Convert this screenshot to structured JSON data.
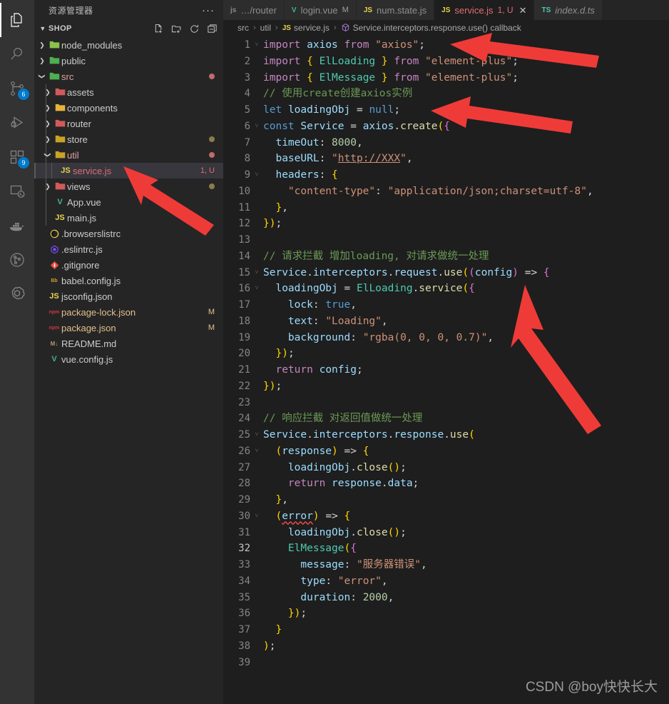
{
  "colors": {
    "activitybar_bg": "#333333",
    "sidebar_bg": "#252526",
    "editor_bg": "#1e1e1e",
    "tab_active_bg": "#1e1e1e",
    "badge_bg": "#007acc",
    "accent_arrow": "#ef3b38",
    "selection_bg": "#37373d",
    "error_red": "#f14c4c"
  },
  "activitybar": {
    "items": [
      {
        "name": "explorer",
        "icon": "files-icon",
        "active": true,
        "badge": ""
      },
      {
        "name": "search",
        "icon": "search-icon",
        "active": false,
        "badge": ""
      },
      {
        "name": "source-control",
        "icon": "source-control-icon",
        "active": false,
        "badge": "6"
      },
      {
        "name": "run-and-debug",
        "icon": "run-debug-icon",
        "active": false,
        "badge": ""
      },
      {
        "name": "extensions",
        "icon": "extensions-icon",
        "active": false,
        "badge": "9"
      },
      {
        "name": "remote-explorer",
        "icon": "remote-explorer-icon",
        "active": false,
        "badge": ""
      },
      {
        "name": "docker",
        "icon": "docker-whale-icon",
        "active": false,
        "badge": ""
      },
      {
        "name": "gitlens",
        "icon": "gitlens-icon",
        "active": false,
        "badge": ""
      },
      {
        "name": "chatgpt",
        "icon": "chatgpt-icon",
        "active": false,
        "badge": ""
      }
    ]
  },
  "sidebar": {
    "title": "资源管理器",
    "more_actions": "···",
    "section": {
      "label": "SHOP",
      "actions": [
        "new-file",
        "new-folder",
        "refresh",
        "collapse-all"
      ]
    },
    "tree": [
      {
        "label": "node_modules",
        "type": "folder",
        "indent": 1,
        "arrow": "collapsed",
        "icon": "folder-node-icon",
        "icon_color": "#8bc34a",
        "color": "#cccccc",
        "badge": "",
        "dot": ""
      },
      {
        "label": "public",
        "type": "folder",
        "indent": 1,
        "arrow": "collapsed",
        "icon": "folder-public-icon",
        "icon_color": "#4caf50",
        "color": "#cccccc",
        "badge": "",
        "dot": ""
      },
      {
        "label": "src",
        "type": "folder",
        "indent": 1,
        "arrow": "expanded",
        "icon": "folder-src-icon",
        "icon_color": "#4caf50",
        "color": "#e2a0a0",
        "badge": "",
        "dot": "#c06c6c"
      },
      {
        "label": "assets",
        "type": "folder",
        "indent": 2,
        "arrow": "collapsed",
        "icon": "folder-assets-icon",
        "icon_color": "#d15a5a",
        "color": "#cccccc",
        "badge": "",
        "dot": ""
      },
      {
        "label": "components",
        "type": "folder",
        "indent": 2,
        "arrow": "collapsed",
        "icon": "folder-components-icon",
        "icon_color": "#e8b339",
        "color": "#cccccc",
        "badge": "",
        "dot": ""
      },
      {
        "label": "router",
        "type": "folder",
        "indent": 2,
        "arrow": "collapsed",
        "icon": "folder-router-icon",
        "icon_color": "#d15a5a",
        "color": "#cccccc",
        "badge": "",
        "dot": ""
      },
      {
        "label": "store",
        "type": "folder",
        "indent": 2,
        "arrow": "collapsed",
        "icon": "folder-store-icon",
        "icon_color": "#c9a227",
        "color": "#cccccc",
        "badge": "",
        "dot": "#8a7b4a"
      },
      {
        "label": "util",
        "type": "folder",
        "indent": 2,
        "arrow": "expanded",
        "icon": "folder-util-icon",
        "icon_color": "#c9a227",
        "color": "#e2a0a0",
        "badge": "",
        "dot": "#c06c6c"
      },
      {
        "label": "service.js",
        "type": "file",
        "indent": 3,
        "arrow": "none",
        "icon": "js-file-icon",
        "icon_color": "#e8d44d",
        "color": "#e06c75",
        "badge": "1, U",
        "badge_color": "#e06c75",
        "dot": "",
        "selected": true
      },
      {
        "label": "views",
        "type": "folder",
        "indent": 2,
        "arrow": "collapsed",
        "icon": "folder-views-icon",
        "icon_color": "#d15a5a",
        "color": "#cccccc",
        "badge": "",
        "dot": "#8a7b4a"
      },
      {
        "label": "App.vue",
        "type": "file",
        "indent": 2,
        "arrow": "none",
        "icon": "vue-file-icon",
        "icon_color": "#41b883",
        "color": "#cccccc",
        "badge": "",
        "dot": ""
      },
      {
        "label": "main.js",
        "type": "file",
        "indent": 2,
        "arrow": "none",
        "icon": "js-file-icon",
        "icon_color": "#e8d44d",
        "color": "#cccccc",
        "badge": "",
        "dot": ""
      },
      {
        "label": ".browserslistrc",
        "type": "file",
        "indent": 1,
        "arrow": "none",
        "icon": "browserslist-file-icon",
        "icon_color": "#f5d547",
        "color": "#cccccc",
        "badge": "",
        "dot": ""
      },
      {
        "label": ".eslintrc.js",
        "type": "file",
        "indent": 1,
        "arrow": "none",
        "icon": "eslint-file-icon",
        "icon_color": "#7c4dff",
        "color": "#cccccc",
        "badge": "",
        "dot": ""
      },
      {
        "label": ".gitignore",
        "type": "file",
        "indent": 1,
        "arrow": "none",
        "icon": "git-file-icon",
        "icon_color": "#e8503a",
        "color": "#cccccc",
        "badge": "",
        "dot": ""
      },
      {
        "label": "babel.config.js",
        "type": "file",
        "indent": 1,
        "arrow": "none",
        "icon": "babel-file-icon",
        "icon_color": "#c9a227",
        "color": "#cccccc",
        "badge": "",
        "dot": ""
      },
      {
        "label": "jsconfig.json",
        "type": "file",
        "indent": 1,
        "arrow": "none",
        "icon": "json-js-file-icon",
        "icon_color": "#e8d44d",
        "color": "#cccccc",
        "badge": "",
        "dot": ""
      },
      {
        "label": "package-lock.json",
        "type": "file",
        "indent": 1,
        "arrow": "none",
        "icon": "npm-file-icon",
        "icon_color": "#cb3837",
        "color": "#e2c08d",
        "badge": "M",
        "badge_color": "#e2c08d",
        "dot": ""
      },
      {
        "label": "package.json",
        "type": "file",
        "indent": 1,
        "arrow": "none",
        "icon": "npm-file-icon",
        "icon_color": "#cb3837",
        "color": "#e2c08d",
        "badge": "M",
        "badge_color": "#e2c08d",
        "dot": ""
      },
      {
        "label": "README.md",
        "type": "file",
        "indent": 1,
        "arrow": "none",
        "icon": "markdown-file-icon",
        "icon_color": "#b9926a",
        "color": "#cccccc",
        "badge": "",
        "dot": ""
      },
      {
        "label": "vue.config.js",
        "type": "file",
        "indent": 1,
        "arrow": "none",
        "icon": "vue-config-file-icon",
        "icon_color": "#41b883",
        "color": "#cccccc",
        "badge": "",
        "dot": ""
      }
    ]
  },
  "tabs": [
    {
      "label": "…/router",
      "icon": "js-icon",
      "icon_text": "js",
      "icon_color": "#8a8a8a",
      "modified": "",
      "badge": "",
      "active": false,
      "closable": false,
      "italic": false
    },
    {
      "label": "login.vue",
      "icon": "vue-icon",
      "icon_text": "V",
      "icon_color": "#41b883",
      "modified": "M",
      "badge": "",
      "active": false,
      "closable": false,
      "italic": false
    },
    {
      "label": "num.state.js",
      "icon": "js-icon",
      "icon_text": "JS",
      "icon_color": "#e8d44d",
      "modified": "",
      "badge": "",
      "active": false,
      "closable": false,
      "italic": false
    },
    {
      "label": "service.js",
      "icon": "js-icon",
      "icon_text": "JS",
      "icon_color": "#e8d44d",
      "modified": "",
      "badge": "1, U",
      "badge_color": "#e06c75",
      "label_color": "#e06c75",
      "active": true,
      "closable": true,
      "close_glyph": "✕",
      "italic": false
    },
    {
      "label": "index.d.ts",
      "icon": "ts-icon",
      "icon_text": "TS",
      "icon_color": "#4ec9b0",
      "modified": "",
      "badge": "",
      "active": false,
      "closable": false,
      "italic": true
    }
  ],
  "breadcrumb": {
    "items": [
      "src",
      "util",
      "service.js",
      "Service.interceptors.response.use() callback"
    ],
    "file_icon_text": "JS",
    "symbol_icon": "symbol-object-icon",
    "separator": "›"
  },
  "editor": {
    "language": "javascript",
    "total_lines": 39,
    "cursor_line": 32,
    "lines": [
      {
        "n": 1,
        "fold": "expanded"
      },
      {
        "n": 2,
        "fold": ""
      },
      {
        "n": 3,
        "fold": ""
      },
      {
        "n": 4,
        "fold": ""
      },
      {
        "n": 5,
        "fold": ""
      },
      {
        "n": 6,
        "fold": "expanded"
      },
      {
        "n": 7,
        "fold": ""
      },
      {
        "n": 8,
        "fold": ""
      },
      {
        "n": 9,
        "fold": "expanded"
      },
      {
        "n": 10,
        "fold": ""
      },
      {
        "n": 11,
        "fold": ""
      },
      {
        "n": 12,
        "fold": ""
      },
      {
        "n": 13,
        "fold": ""
      },
      {
        "n": 14,
        "fold": ""
      },
      {
        "n": 15,
        "fold": "expanded"
      },
      {
        "n": 16,
        "fold": "expanded"
      },
      {
        "n": 17,
        "fold": ""
      },
      {
        "n": 18,
        "fold": ""
      },
      {
        "n": 19,
        "fold": ""
      },
      {
        "n": 20,
        "fold": ""
      },
      {
        "n": 21,
        "fold": ""
      },
      {
        "n": 22,
        "fold": ""
      },
      {
        "n": 23,
        "fold": ""
      },
      {
        "n": 24,
        "fold": ""
      },
      {
        "n": 25,
        "fold": "expanded"
      },
      {
        "n": 26,
        "fold": "expanded"
      },
      {
        "n": 27,
        "fold": ""
      },
      {
        "n": 28,
        "fold": ""
      },
      {
        "n": 29,
        "fold": ""
      },
      {
        "n": 30,
        "fold": "expanded"
      },
      {
        "n": 31,
        "fold": ""
      },
      {
        "n": 32,
        "fold": ""
      },
      {
        "n": 33,
        "fold": ""
      },
      {
        "n": 34,
        "fold": ""
      },
      {
        "n": 35,
        "fold": ""
      },
      {
        "n": 36,
        "fold": ""
      },
      {
        "n": 37,
        "fold": ""
      },
      {
        "n": 38,
        "fold": ""
      },
      {
        "n": 39,
        "fold": ""
      }
    ],
    "source": [
      "import axios from \"axios\";",
      "import { ElLoading } from \"element-plus\";",
      "import { ElMessage } from \"element-plus\";",
      "// 使用create创建axios实例",
      "let loadingObj = null;",
      "const Service = axios.create({",
      "  timeOut: 8000,",
      "  baseURL: \"http://XXX\",",
      "  headers: {",
      "    \"content-type\": \"application/json;charset=utf-8\",",
      "  },",
      "});",
      "",
      "// 请求拦截 增加loading, 对请求做统一处理",
      "Service.interceptors.request.use((config) => {",
      "  loadingObj = ElLoading.service({",
      "    lock: true,",
      "    text: \"Loading\",",
      "    background: \"rgba(0, 0, 0, 0.7)\",",
      "  });",
      "  return config;",
      "});",
      "",
      "// 响应拦截 对返回值做统一处理",
      "Service.interceptors.response.use(",
      "  (response) => {",
      "    loadingObj.close();",
      "    return response.data;",
      "  },",
      "  (error) => {",
      "    loadingObj.close();",
      "    ElMessage({",
      "      message: \"服务器错误\",",
      "      type: \"error\",",
      "      duration: 2000,",
      "    });",
      "  }",
      ");",
      ""
    ]
  },
  "annotations": {
    "arrows": [
      {
        "name": "arrow-to-line1-import",
        "target": "line 1 import axios"
      },
      {
        "name": "arrow-to-line5-loadingobj",
        "target": "line 5 let loadingObj"
      },
      {
        "name": "arrow-to-sidebar-service-js",
        "target": "sidebar service.js"
      },
      {
        "name": "arrow-to-line16-elloading",
        "target": "line 16 ElLoading.service"
      }
    ]
  },
  "watermark": {
    "text": "CSDN @boy快快长大"
  }
}
